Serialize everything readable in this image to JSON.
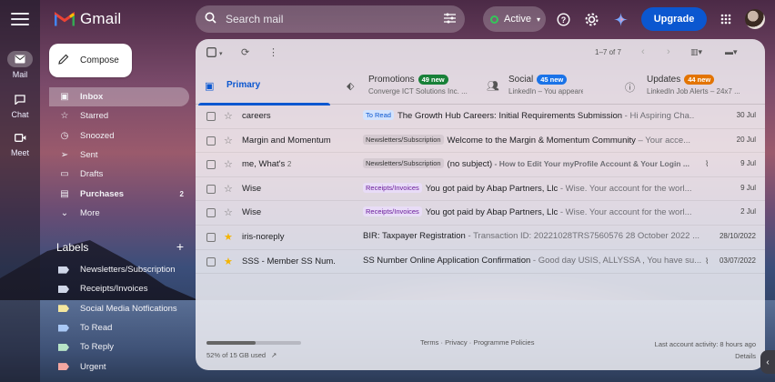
{
  "app": {
    "name": "Gmail"
  },
  "colors": {
    "accent": "#0b57d0",
    "upgrade": "#0b57d0",
    "promotions_badge": "#188038",
    "social_badge": "#1a73e8",
    "updates_badge": "#e37400"
  },
  "rail": {
    "items": [
      {
        "label": "Mail",
        "icon": "mail-icon"
      },
      {
        "label": "Chat",
        "icon": "chat-icon"
      },
      {
        "label": "Meet",
        "icon": "video-icon"
      }
    ]
  },
  "search": {
    "placeholder": "Search mail"
  },
  "status": {
    "label": "Active"
  },
  "upgrade_label": "Upgrade",
  "compose_label": "Compose",
  "nav": {
    "items": [
      {
        "label": "Inbox",
        "icon": "inbox-icon",
        "count": ""
      },
      {
        "label": "Starred",
        "icon": "star-icon",
        "count": ""
      },
      {
        "label": "Snoozed",
        "icon": "clock-icon",
        "count": ""
      },
      {
        "label": "Sent",
        "icon": "send-icon",
        "count": ""
      },
      {
        "label": "Drafts",
        "icon": "draft-icon",
        "count": ""
      },
      {
        "label": "Purchases",
        "icon": "tag-icon",
        "count": "2"
      },
      {
        "label": "More",
        "icon": "chevron-down-icon",
        "count": ""
      }
    ]
  },
  "labels": {
    "heading": "Labels",
    "add": "+",
    "items": [
      {
        "label": "Newsletters/Subscription",
        "color": "#d0d7e8"
      },
      {
        "label": "Receipts/Invoices",
        "color": "#d0d7e8"
      },
      {
        "label": "Social Media Notfications",
        "color": "#f5e79e"
      },
      {
        "label": "To Read",
        "color": "#a9c8f5"
      },
      {
        "label": "To Reply",
        "color": "#b7e4c7"
      },
      {
        "label": "Urgent",
        "color": "#f4a7a1"
      }
    ]
  },
  "toolbar": {
    "pagination": "1–7 of 7"
  },
  "tabs": [
    {
      "name": "Primary",
      "badge": "",
      "sub": ""
    },
    {
      "name": "Promotions",
      "badge": "49 new",
      "sub": "Converge ICT Solutions Inc. ..."
    },
    {
      "name": "Social",
      "badge": "45 new",
      "sub": "LinkedIn – You appeared in r..."
    },
    {
      "name": "Updates",
      "badge": "44 new",
      "sub": "LinkedIn Job Alerts – 24x7 ..."
    }
  ],
  "emails": [
    {
      "sender": "careers",
      "count": "",
      "starred": false,
      "label": "To Read",
      "label_style": "blue",
      "subject": "The Growth Hub Careers: Initial Requirements Submission",
      "snippet": " - Hi Aspiring Cha...",
      "attachment": false,
      "date": "30 Jul"
    },
    {
      "sender": "Margin and Momentum",
      "count": "",
      "starred": false,
      "label": "Newsletters/Subscription",
      "label_style": "grey",
      "subject": "Welcome to the Margin & Momentum Community",
      "snippet": " – Your acce...",
      "attachment": false,
      "date": "20 Jul"
    },
    {
      "sender": "me, What's",
      "count": "2",
      "starred": false,
      "label": "Newsletters/Subscription",
      "label_style": "grey",
      "subject": "(no subject)",
      "snippet": " - How to Edit Your myProfile Account & Your Login ...",
      "attachment": true,
      "date": "9 Jul"
    },
    {
      "sender": "Wise",
      "count": "",
      "starred": false,
      "label": "Receipts/Invoices",
      "label_style": "purple",
      "subject": "You got paid by Abap Partners, Llc",
      "snippet": " - Wise. Your account for the worl...",
      "attachment": false,
      "date": "9 Jul"
    },
    {
      "sender": "Wise",
      "count": "",
      "starred": false,
      "label": "Receipts/Invoices",
      "label_style": "purple",
      "subject": "You got paid by Abap Partners, Llc",
      "snippet": " - Wise. Your account for the worl...",
      "attachment": false,
      "date": "2 Jul"
    },
    {
      "sender": "iris-noreply",
      "count": "",
      "starred": true,
      "label": "",
      "label_style": "",
      "subject": "BIR: Taxpayer Registration",
      "snippet": " - Transaction ID: 20221028TRS7560576 28 October 2022 ...",
      "attachment": false,
      "date": "28/10/2022"
    },
    {
      "sender": "SSS - Member SS Num.",
      "count": "",
      "starred": true,
      "label": "",
      "label_style": "",
      "subject": "SS Number Online Application Confirmation",
      "snippet": " - Good day USIS, ALLYSSA , You have su...",
      "attachment": true,
      "date": "03/07/2022"
    }
  ],
  "footer": {
    "storage": "52% of 15 GB used",
    "storage_fraction": 0.52,
    "terms": "Terms · Privacy · Programme Policies",
    "activity": "Last account activity: 8 hours ago",
    "details": "Details"
  }
}
